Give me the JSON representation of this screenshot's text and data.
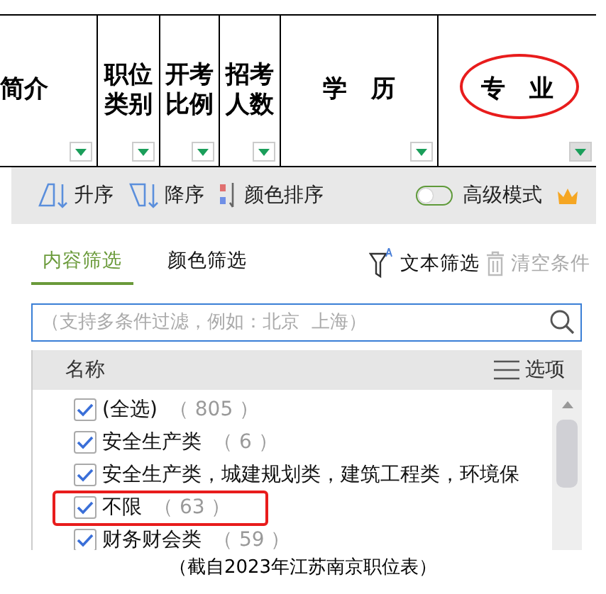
{
  "columns": [
    {
      "label": "简介",
      "circled": false
    },
    {
      "label": "职位类别",
      "circled": false
    },
    {
      "label": "开考比例",
      "circled": false
    },
    {
      "label": "招考人数",
      "circled": false
    },
    {
      "label": "学　历",
      "circled": false
    },
    {
      "label": "专　业",
      "circled": true
    }
  ],
  "toolbar": {
    "ascending": "升序",
    "descending": "降序",
    "color_sort": "颜色排序",
    "advanced_mode": {
      "label": "高级模式",
      "on": false
    }
  },
  "tabs": [
    {
      "label": "内容筛选",
      "selected": true
    },
    {
      "label": "颜色筛选",
      "selected": false
    }
  ],
  "text_filter": "文本筛选",
  "clear": {
    "label": "清空条件",
    "disabled": true
  },
  "search": {
    "placeholder": "（支持多条件过滤，例如：北京  上海）"
  },
  "list": {
    "name_header": "名称",
    "options": "选项",
    "items": [
      {
        "label": "(全选)",
        "count": "（ 805 ）",
        "checked": true,
        "highlighted": false
      },
      {
        "label": "安全生产类",
        "count": "（ 6 ）",
        "checked": true,
        "highlighted": false
      },
      {
        "label": "安全生产类，城建规划类，建筑工程类，环境保",
        "checked": true,
        "highlighted": false
      },
      {
        "label": "不限",
        "count": "（ 63 ）",
        "checked": true,
        "highlighted": true
      },
      {
        "label": "财务财会类",
        "count": "（ 59 ）",
        "checked": true,
        "highlighted": false
      }
    ]
  },
  "caption": "（截自2023年江苏南京职位表）"
}
